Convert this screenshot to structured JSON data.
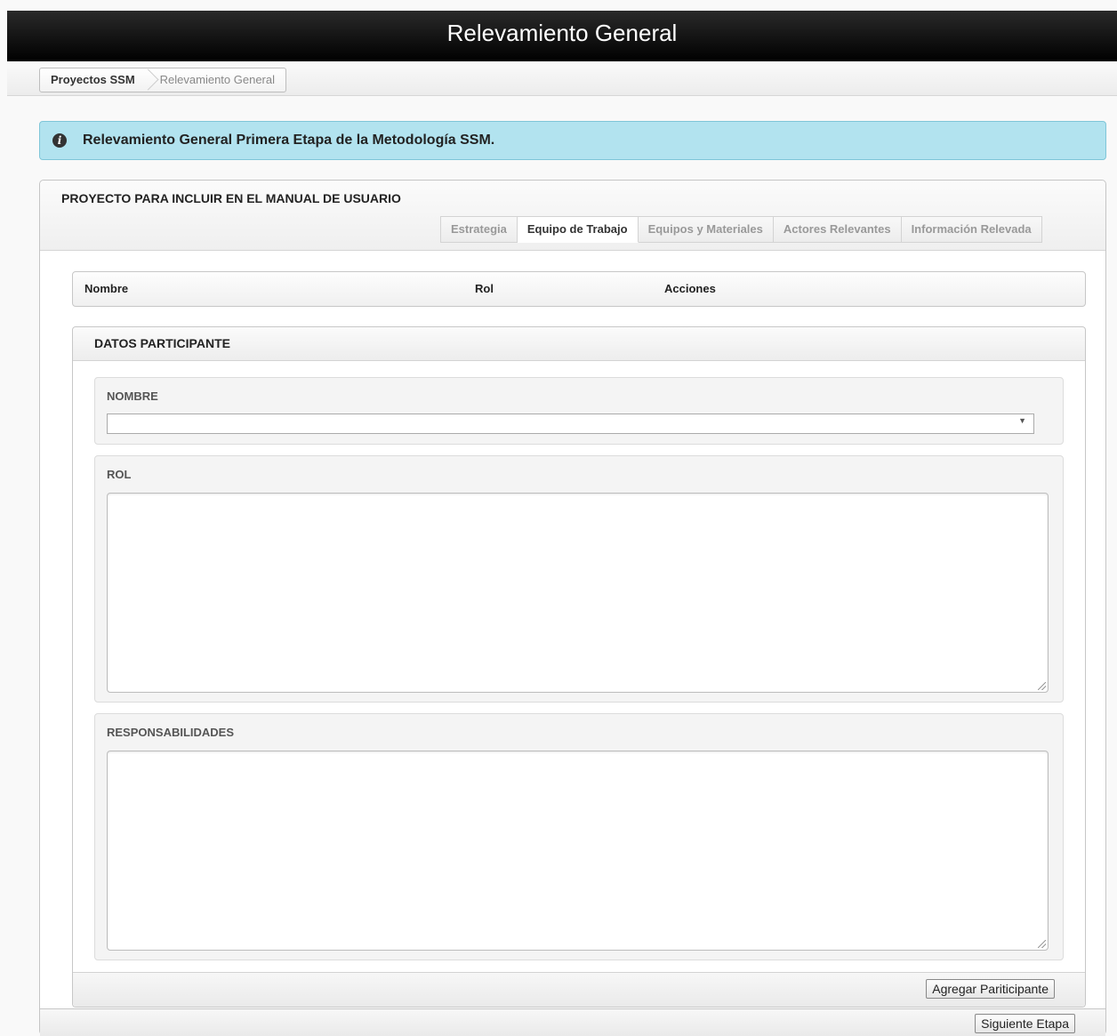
{
  "header": {
    "title": "Relevamiento General"
  },
  "breadcrumb": {
    "items": [
      "Proyectos SSM",
      "Relevamiento General"
    ]
  },
  "info": {
    "message": "Relevamiento General Primera Etapa de la Metodología SSM.",
    "icon": "info-icon"
  },
  "project": {
    "title": "PROYECTO PARA INCLUIR EN EL MANUAL DE USUARIO",
    "tabs": [
      {
        "label": "Estrategia",
        "active": false
      },
      {
        "label": "Equipo de Trabajo",
        "active": true
      },
      {
        "label": "Equipos y Materiales",
        "active": false
      },
      {
        "label": "Actores Relevantes",
        "active": false
      },
      {
        "label": "Información Relevada",
        "active": false
      }
    ]
  },
  "table": {
    "columns": [
      "Nombre",
      "Rol",
      "Acciones"
    ]
  },
  "form": {
    "title": "DATOS PARTICIPANTE",
    "nombre_label": "NOMBRE",
    "nombre_value": "",
    "rol_label": "ROL",
    "rol_value": "",
    "responsabilidades_label": "RESPONSABILIDADES",
    "responsabilidades_value": "",
    "add_button": "Agregar Pariticipante"
  },
  "footer": {
    "next_button": "Siguiente Etapa"
  }
}
